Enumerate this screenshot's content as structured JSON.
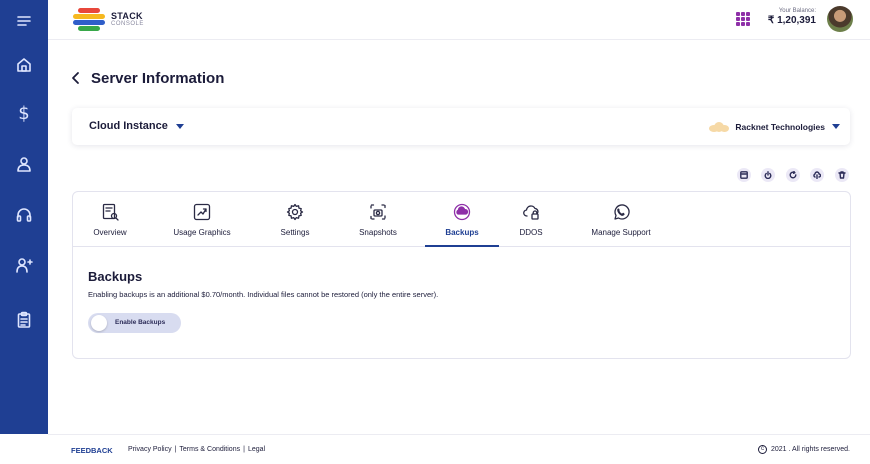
{
  "brand": {
    "name": "STACK",
    "tagline": "CONSOLE",
    "logo_colors": [
      "#e8473b",
      "#f6b81f",
      "#2f5ec9",
      "#38a849"
    ]
  },
  "header": {
    "balance_label": "Your Balance:",
    "balance_value": "₹ 1,20,391",
    "apps_icon": "grid-icon",
    "accent_color": "#8e2fa8"
  },
  "sidebar": {
    "color": "#1f3f93",
    "items": [
      {
        "icon": "menu-icon"
      },
      {
        "icon": "home-icon"
      },
      {
        "icon": "dollar-icon",
        "glyph": "$"
      },
      {
        "icon": "user-icon"
      },
      {
        "icon": "headset-icon"
      },
      {
        "icon": "add-user-icon"
      },
      {
        "icon": "clipboard-icon"
      }
    ]
  },
  "page": {
    "title": "Server Information"
  },
  "instance": {
    "selected": "Cloud Instance",
    "company": "Racknet Technologies"
  },
  "actions": [
    "console-icon",
    "power-icon",
    "restart-icon",
    "cloud-upload-icon",
    "trash-icon"
  ],
  "tabs": [
    {
      "label": "Overview",
      "icon": "document-search-icon",
      "active": false
    },
    {
      "label": "Usage Graphics",
      "icon": "chart-up-icon",
      "active": false
    },
    {
      "label": "Settings",
      "icon": "gear-icon",
      "active": false
    },
    {
      "label": "Snapshots",
      "icon": "camera-icon",
      "active": false
    },
    {
      "label": "Backups",
      "icon": "cloud-backup-icon",
      "active": true
    },
    {
      "label": "DDOS",
      "icon": "cloud-lock-icon",
      "active": false
    },
    {
      "label": "Manage Support",
      "icon": "whatsapp-icon",
      "active": false
    }
  ],
  "backups": {
    "title": "Backups",
    "description": "Enabling backups is an additional $0.70/month. Individual files cannot be restored (only the entire server).",
    "toggle_label": "Enable Backups",
    "enabled": false
  },
  "footer": {
    "feedback": "FEEDBACK",
    "links": [
      "Privacy Policy",
      "Terms & Conditions",
      "Legal"
    ],
    "separator": "|",
    "copyright": "2021 . All rights reserved."
  }
}
